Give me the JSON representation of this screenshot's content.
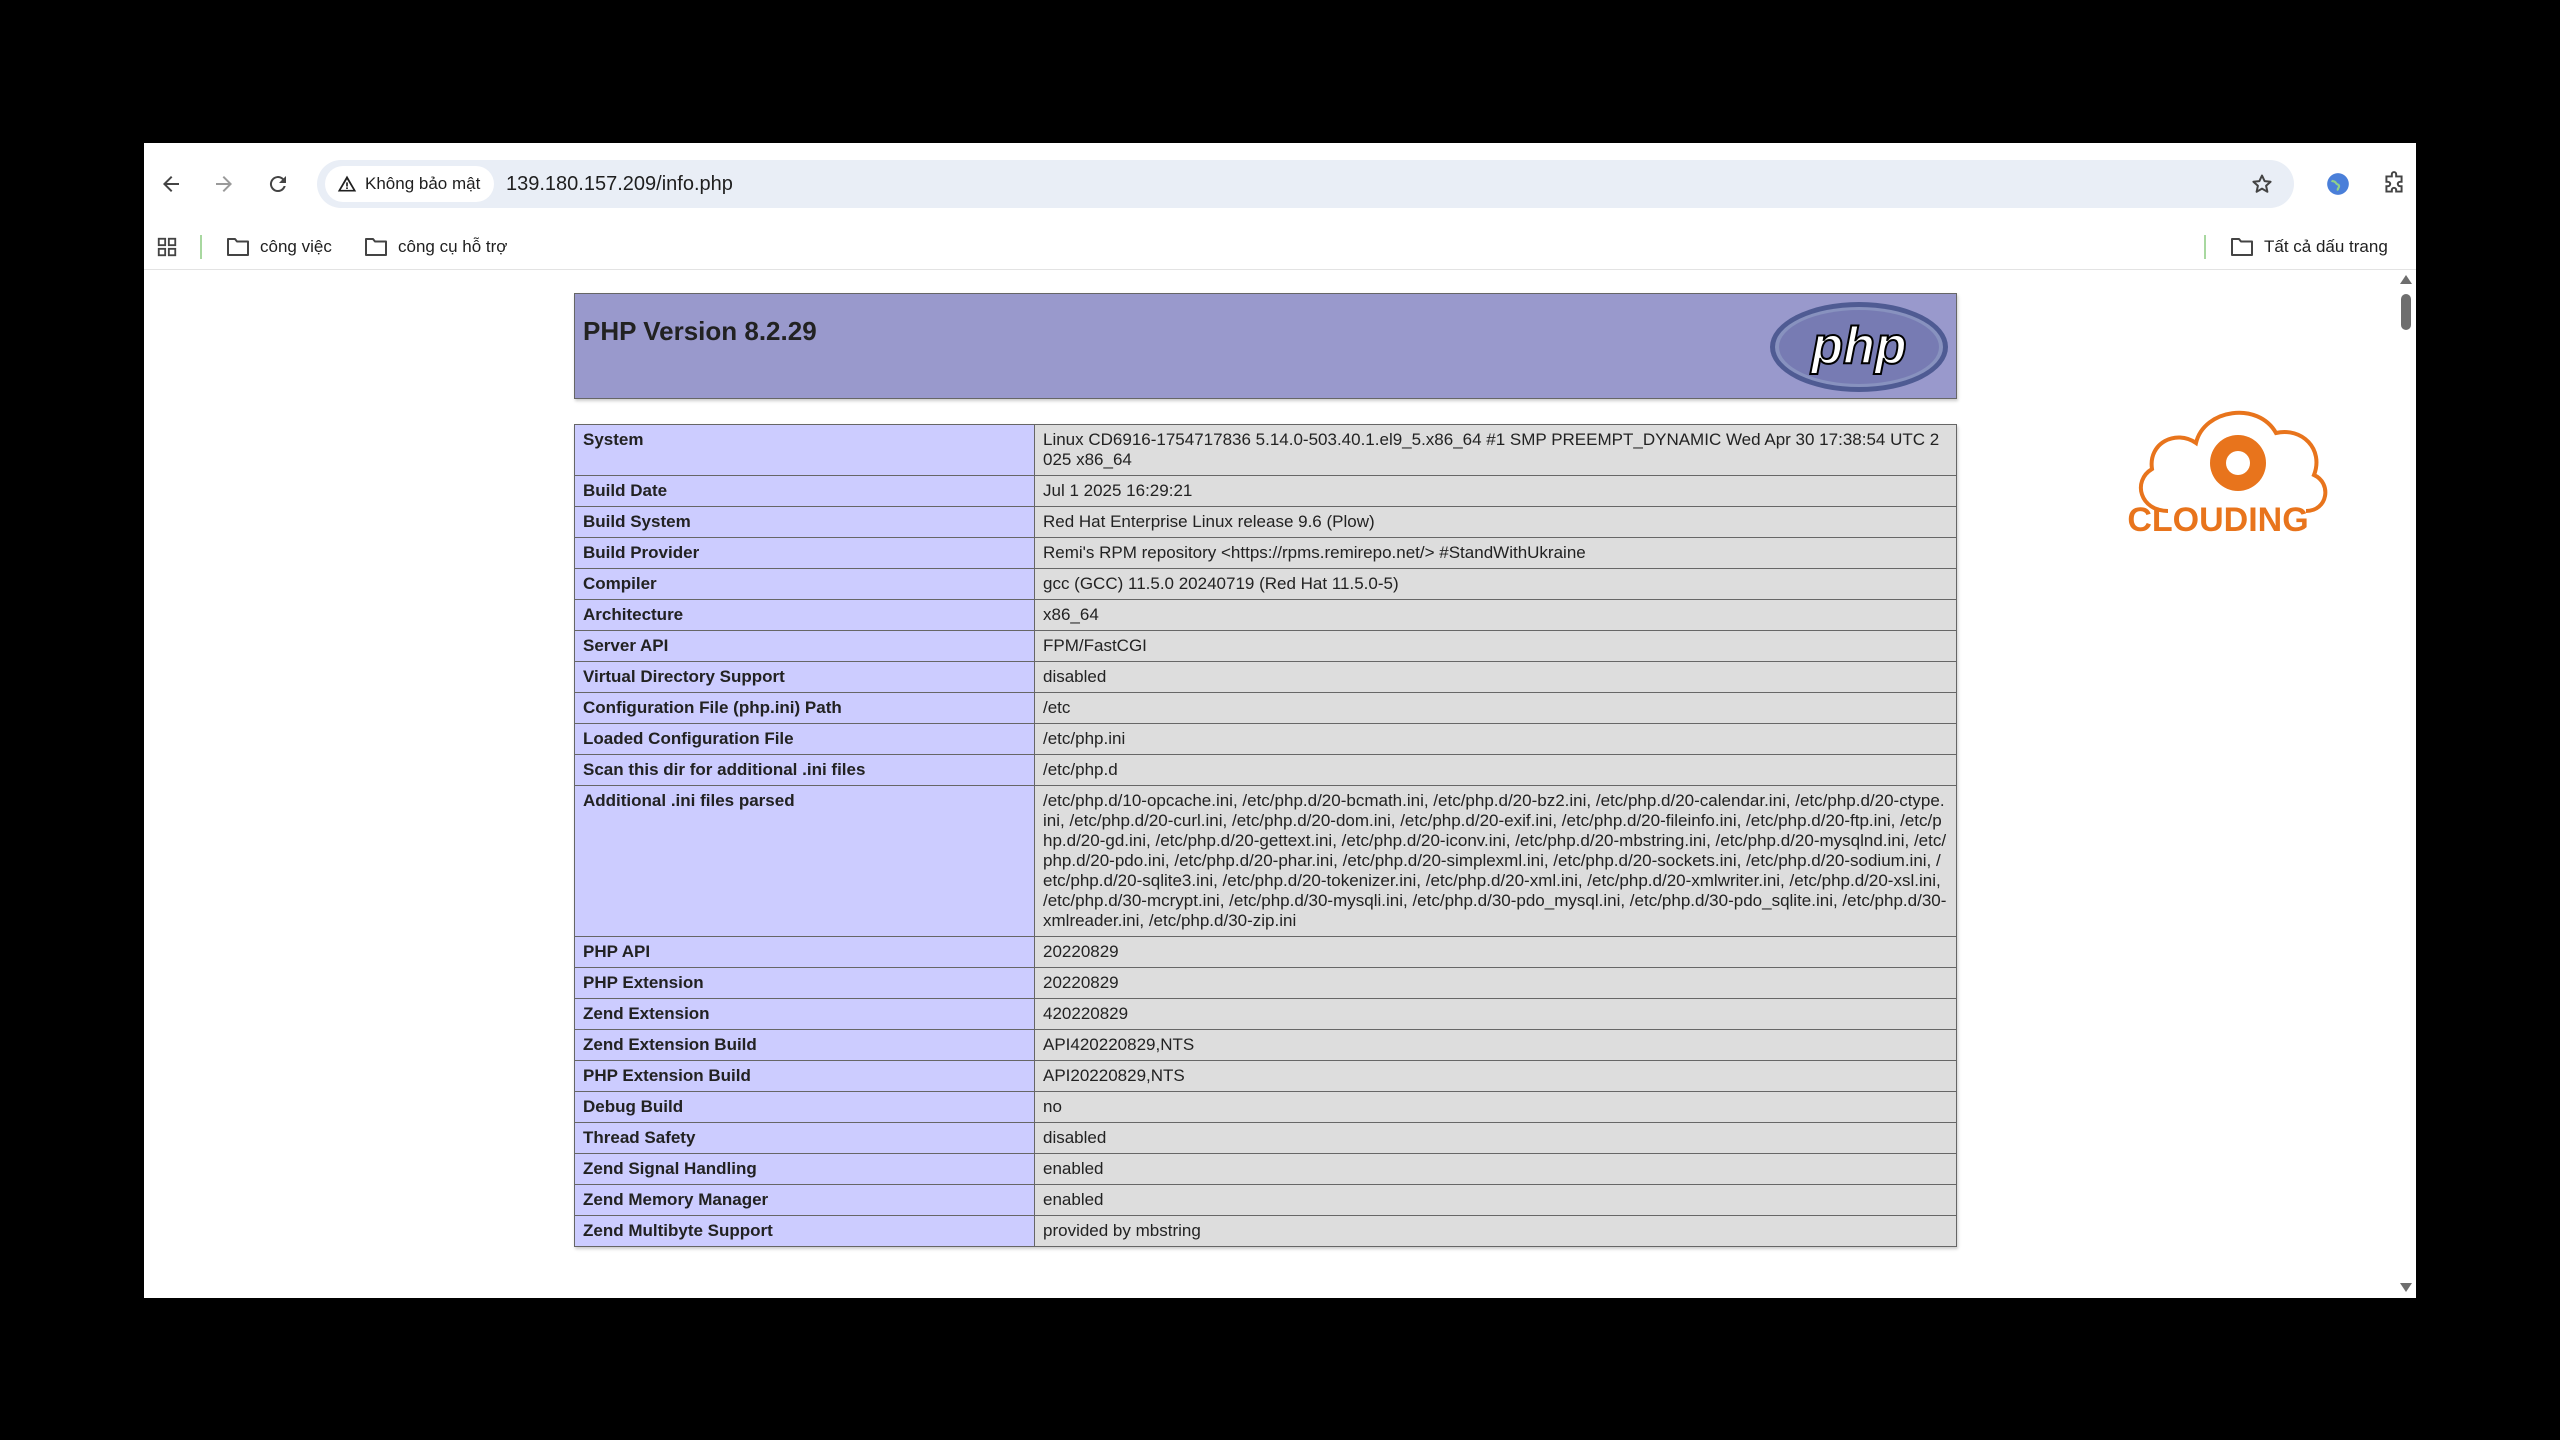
{
  "browser": {
    "security_label": "Không bảo mật",
    "url": "139.180.157.209/info.php",
    "bookmarks": [
      "công việc",
      "công cụ hỗ trợ"
    ],
    "all_bookmarks": "Tất cả dấu trang"
  },
  "php": {
    "title": "PHP Version 8.2.29",
    "logo_text": "php",
    "rows": [
      {
        "key": "System",
        "value": "Linux CD6916-1754717836 5.14.0-503.40.1.el9_5.x86_64 #1 SMP PREEMPT_DYNAMIC Wed Apr 30 17:38:54 UTC 2025 x86_64"
      },
      {
        "key": "Build Date",
        "value": "Jul 1 2025 16:29:21"
      },
      {
        "key": "Build System",
        "value": "Red Hat Enterprise Linux release 9.6 (Plow)"
      },
      {
        "key": "Build Provider",
        "value": "Remi's RPM repository <https://rpms.remirepo.net/> #StandWithUkraine"
      },
      {
        "key": "Compiler",
        "value": "gcc (GCC) 11.5.0 20240719 (Red Hat 11.5.0-5)"
      },
      {
        "key": "Architecture",
        "value": "x86_64"
      },
      {
        "key": "Server API",
        "value": "FPM/FastCGI"
      },
      {
        "key": "Virtual Directory Support",
        "value": "disabled"
      },
      {
        "key": "Configuration File (php.ini) Path",
        "value": "/etc"
      },
      {
        "key": "Loaded Configuration File",
        "value": "/etc/php.ini"
      },
      {
        "key": "Scan this dir for additional .ini files",
        "value": "/etc/php.d"
      },
      {
        "key": "Additional .ini files parsed",
        "value": "/etc/php.d/10-opcache.ini, /etc/php.d/20-bcmath.ini, /etc/php.d/20-bz2.ini, /etc/php.d/20-calendar.ini, /etc/php.d/20-ctype.ini, /etc/php.d/20-curl.ini, /etc/php.d/20-dom.ini, /etc/php.d/20-exif.ini, /etc/php.d/20-fileinfo.ini, /etc/php.d/20-ftp.ini, /etc/php.d/20-gd.ini, /etc/php.d/20-gettext.ini, /etc/php.d/20-iconv.ini, /etc/php.d/20-mbstring.ini, /etc/php.d/20-mysqlnd.ini, /etc/php.d/20-pdo.ini, /etc/php.d/20-phar.ini, /etc/php.d/20-simplexml.ini, /etc/php.d/20-sockets.ini, /etc/php.d/20-sodium.ini, /etc/php.d/20-sqlite3.ini, /etc/php.d/20-tokenizer.ini, /etc/php.d/20-xml.ini, /etc/php.d/20-xmlwriter.ini, /etc/php.d/20-xsl.ini, /etc/php.d/30-mcrypt.ini, /etc/php.d/30-mysqli.ini, /etc/php.d/30-pdo_mysql.ini, /etc/php.d/30-pdo_sqlite.ini, /etc/php.d/30-xmlreader.ini, /etc/php.d/30-zip.ini"
      },
      {
        "key": "PHP API",
        "value": "20220829"
      },
      {
        "key": "PHP Extension",
        "value": "20220829"
      },
      {
        "key": "Zend Extension",
        "value": "420220829"
      },
      {
        "key": "Zend Extension Build",
        "value": "API420220829,NTS"
      },
      {
        "key": "PHP Extension Build",
        "value": "API20220829,NTS"
      },
      {
        "key": "Debug Build",
        "value": "no"
      },
      {
        "key": "Thread Safety",
        "value": "disabled"
      },
      {
        "key": "Zend Signal Handling",
        "value": "enabled"
      },
      {
        "key": "Zend Memory Manager",
        "value": "enabled"
      },
      {
        "key": "Zend Multibyte Support",
        "value": "provided by mbstring"
      }
    ]
  },
  "watermark": {
    "text": "CLOUDING",
    "color": "#e8741c"
  },
  "colors": {
    "header_bg": "#9999cc",
    "key_bg": "#ccccff",
    "value_bg": "#dddddd"
  }
}
